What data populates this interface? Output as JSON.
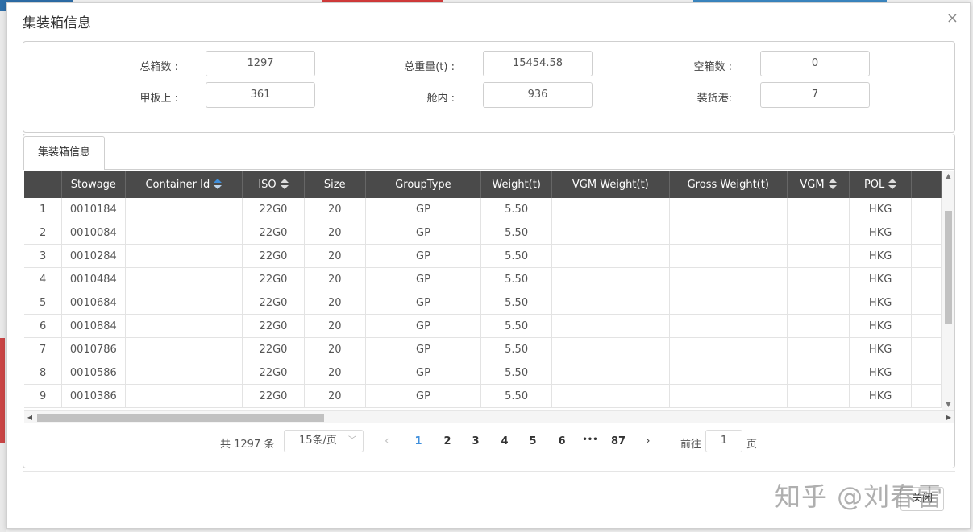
{
  "dialog": {
    "title": "集装箱信息",
    "close_icon": "close-icon",
    "close_glyph": "×"
  },
  "summary": {
    "total_boxes_label": "总箱数 :",
    "total_boxes": "1297",
    "total_weight_label": "总重量(t) :",
    "total_weight": "15454.58",
    "empty_boxes_label": "空箱数 :",
    "empty_boxes": "0",
    "on_deck_label": "甲板上 :",
    "on_deck": "361",
    "in_hold_label": "舱内 :",
    "in_hold": "936",
    "loading_ports_label": "装货港:",
    "loading_ports": "7"
  },
  "tab": {
    "label": "集装箱信息"
  },
  "grid": {
    "columns": [
      {
        "key": "idx",
        "label": "",
        "sortable": false
      },
      {
        "key": "stowage",
        "label": "Stowage",
        "sortable": false
      },
      {
        "key": "container_id",
        "label": "Container Id",
        "sortable": true,
        "active_sort": true
      },
      {
        "key": "iso",
        "label": "ISO",
        "sortable": true
      },
      {
        "key": "size",
        "label": "Size",
        "sortable": false
      },
      {
        "key": "group_type",
        "label": "GroupType",
        "sortable": false
      },
      {
        "key": "weight",
        "label": "Weight(t)",
        "sortable": false
      },
      {
        "key": "vgm_weight",
        "label": "VGM Weight(t)",
        "sortable": false
      },
      {
        "key": "gross_weight",
        "label": "Gross Weight(t)",
        "sortable": false
      },
      {
        "key": "vgm",
        "label": "VGM",
        "sortable": true
      },
      {
        "key": "pol",
        "label": "POL",
        "sortable": true
      },
      {
        "key": "more",
        "label": "",
        "sortable": false
      }
    ],
    "rows": [
      [
        "1",
        "0010184",
        "",
        "22G0",
        "20",
        "GP",
        "5.50",
        "",
        "",
        "",
        "HKG",
        ""
      ],
      [
        "2",
        "0010084",
        "",
        "22G0",
        "20",
        "GP",
        "5.50",
        "",
        "",
        "",
        "HKG",
        ""
      ],
      [
        "3",
        "0010284",
        "",
        "22G0",
        "20",
        "GP",
        "5.50",
        "",
        "",
        "",
        "HKG",
        ""
      ],
      [
        "4",
        "0010484",
        "",
        "22G0",
        "20",
        "GP",
        "5.50",
        "",
        "",
        "",
        "HKG",
        ""
      ],
      [
        "5",
        "0010684",
        "",
        "22G0",
        "20",
        "GP",
        "5.50",
        "",
        "",
        "",
        "HKG",
        ""
      ],
      [
        "6",
        "0010884",
        "",
        "22G0",
        "20",
        "GP",
        "5.50",
        "",
        "",
        "",
        "HKG",
        ""
      ],
      [
        "7",
        "0010786",
        "",
        "22G0",
        "20",
        "GP",
        "5.50",
        "",
        "",
        "",
        "HKG",
        ""
      ],
      [
        "8",
        "0010586",
        "",
        "22G0",
        "20",
        "GP",
        "5.50",
        "",
        "",
        "",
        "HKG",
        ""
      ],
      [
        "9",
        "0010386",
        "",
        "22G0",
        "20",
        "GP",
        "5.50",
        "",
        "",
        "",
        "HKG",
        ""
      ]
    ]
  },
  "pager": {
    "total_text": "共 1297 条",
    "page_size": "15条/页",
    "prev_glyph": "‹",
    "next_glyph": "›",
    "pages": [
      "1",
      "2",
      "3",
      "4",
      "5",
      "6",
      "•••",
      "87"
    ],
    "current_page": "1",
    "goto_label": "前往",
    "goto_value": "1",
    "page_suffix": "页"
  },
  "footer": {
    "close_label": "关闭"
  },
  "watermark": "知乎 @刘春雷",
  "colors": {
    "header_bg": "#4a4a4a",
    "accent_blue": "#3f8fdc"
  }
}
